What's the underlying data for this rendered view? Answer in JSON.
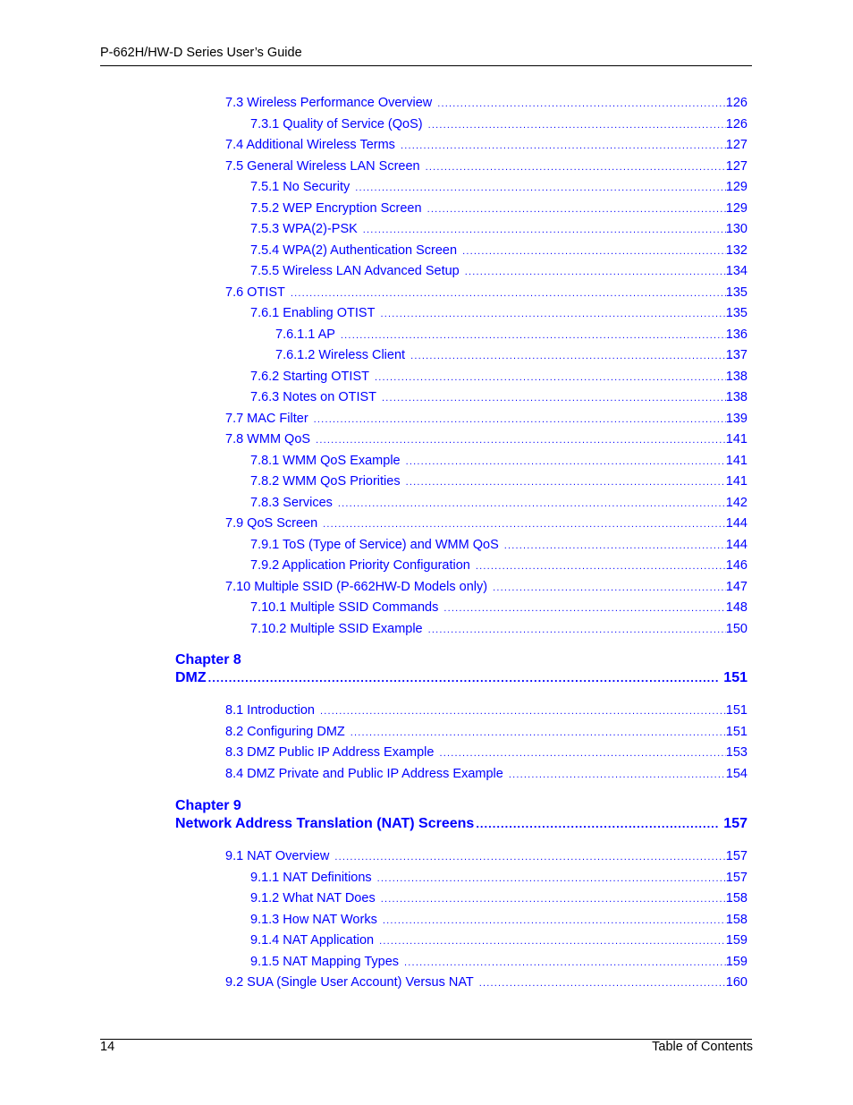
{
  "header": {
    "title": "P-662H/HW-D Series User’s Guide"
  },
  "footer": {
    "page_number": "14",
    "section": "Table of Contents"
  },
  "colors": {
    "link": "#0000ff",
    "text": "#000000",
    "rule": "#000000"
  },
  "toc": {
    "pre_entries": [
      {
        "level": 1,
        "label": "7.3 Wireless Performance Overview",
        "page": "126"
      },
      {
        "level": 2,
        "label": "7.3.1 Quality of Service (QoS)",
        "page": "126"
      },
      {
        "level": 1,
        "label": "7.4 Additional Wireless Terms",
        "page": "127"
      },
      {
        "level": 1,
        "label": "7.5 General Wireless LAN Screen",
        "page": "127"
      },
      {
        "level": 2,
        "label": "7.5.1 No Security",
        "page": "129"
      },
      {
        "level": 2,
        "label": "7.5.2 WEP Encryption Screen",
        "page": "129"
      },
      {
        "level": 2,
        "label": "7.5.3 WPA(2)-PSK",
        "page": "130"
      },
      {
        "level": 2,
        "label": "7.5.4 WPA(2) Authentication Screen",
        "page": "132"
      },
      {
        "level": 2,
        "label": "7.5.5 Wireless LAN Advanced Setup",
        "page": "134"
      },
      {
        "level": 1,
        "label": "7.6 OTIST",
        "page": "135"
      },
      {
        "level": 2,
        "label": "7.6.1 Enabling OTIST",
        "page": "135"
      },
      {
        "level": 3,
        "label": "7.6.1.1 AP",
        "page": "136"
      },
      {
        "level": 3,
        "label": "7.6.1.2 Wireless Client",
        "page": "137"
      },
      {
        "level": 2,
        "label": "7.6.2 Starting OTIST",
        "page": "138"
      },
      {
        "level": 2,
        "label": "7.6.3 Notes on OTIST",
        "page": "138"
      },
      {
        "level": 1,
        "label": "7.7 MAC Filter",
        "page": "139"
      },
      {
        "level": 1,
        "label": "7.8 WMM QoS",
        "page": "141"
      },
      {
        "level": 2,
        "label": "7.8.1 WMM QoS Example",
        "page": "141"
      },
      {
        "level": 2,
        "label": "7.8.2 WMM QoS Priorities",
        "page": "141"
      },
      {
        "level": 2,
        "label": "7.8.3 Services",
        "page": "142"
      },
      {
        "level": 1,
        "label": "7.9 QoS Screen",
        "page": "144"
      },
      {
        "level": 2,
        "label": "7.9.1 ToS (Type of Service) and WMM QoS",
        "page": "144"
      },
      {
        "level": 2,
        "label": "7.9.2 Application Priority Configuration",
        "page": "146"
      },
      {
        "level": 1,
        "label": "7.10 Multiple SSID (P-662HW-D Models only)",
        "page": "147"
      },
      {
        "level": 2,
        "label": "7.10.1 Multiple SSID Commands",
        "page": "148"
      },
      {
        "level": 2,
        "label": "7.10.2 Multiple SSID Example",
        "page": "150"
      }
    ],
    "chapters": [
      {
        "label": "Chapter 8",
        "title": "DMZ",
        "page": "151",
        "entries": [
          {
            "level": 1,
            "label": "8.1 Introduction",
            "page": "151"
          },
          {
            "level": 1,
            "label": "8.2 Configuring DMZ",
            "page": "151"
          },
          {
            "level": 1,
            "label": "8.3 DMZ Public IP Address Example",
            "page": "153"
          },
          {
            "level": 1,
            "label": "8.4 DMZ Private and Public IP Address Example",
            "page": "154"
          }
        ]
      },
      {
        "label": "Chapter 9",
        "title": "Network Address Translation (NAT) Screens",
        "page": "157",
        "entries": [
          {
            "level": 1,
            "label": "9.1 NAT Overview",
            "page": "157"
          },
          {
            "level": 2,
            "label": "9.1.1 NAT Definitions",
            "page": "157"
          },
          {
            "level": 2,
            "label": "9.1.2 What NAT Does",
            "page": "158"
          },
          {
            "level": 2,
            "label": "9.1.3 How NAT Works",
            "page": "158"
          },
          {
            "level": 2,
            "label": "9.1.4 NAT Application",
            "page": "159"
          },
          {
            "level": 2,
            "label": "9.1.5 NAT Mapping Types",
            "page": "159"
          },
          {
            "level": 1,
            "label": "9.2 SUA (Single User Account) Versus NAT",
            "page": "160"
          }
        ]
      }
    ]
  }
}
